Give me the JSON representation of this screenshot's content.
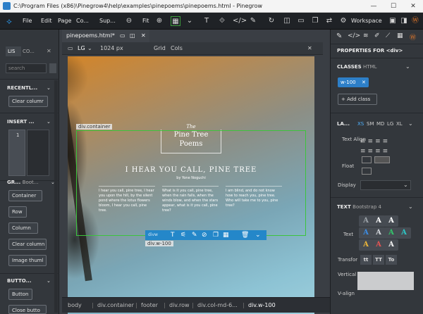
{
  "window": {
    "title": "C:\\Program Files (x86)\\Pinegrow4\\help\\examples\\pinepoems\\pinepoems.html - Pinegrow",
    "minimize": "—",
    "maximize": "☐",
    "close": "✕"
  },
  "menubar": {
    "items": [
      "File",
      "Edit",
      "Page",
      "Co...",
      "Sup..."
    ],
    "zoom_label": "Fit",
    "workspace_label": "Workspace"
  },
  "left_panel": {
    "tab_label": "LIS",
    "tab2_label": "CO...",
    "search_placeholder": "search",
    "recent_header": "RECENTL...",
    "recent_item": "Clear columr",
    "insert_header": "INSERT ...",
    "insert_num": "1",
    "grid_header": "GR...",
    "grid_sub": "Boot...",
    "grid_items": [
      "Container",
      "Row",
      "Column",
      "Clear column",
      "Image thuml"
    ],
    "buttons_header": "BUTTO...",
    "buttons_items": [
      "Button",
      "Close butto"
    ]
  },
  "canvas": {
    "doc_tab": "pinepoems.html*",
    "device": "LG",
    "width_px": "1024 px",
    "grid": "Grid",
    "cols": "Cols",
    "close": "✕",
    "container_label": "div.container",
    "logo_the": "The",
    "logo_line1": "Pine Tree",
    "logo_line2": "Poems",
    "headline": "I HEAR YOU CALL, PINE TREE",
    "byline": "by Yone Noguchi",
    "col1": "I hear you call, pine tree, I hear you upon the hill, by the silent pond where the lotus flowers bloom, I hear you call, pine tree.",
    "col2": "What is it you call, pine tree, when the rain falls, when the winds blow, and when the stars appear, what is it you call, pine tree?",
    "col3": "I am blind, and do not know how to reach you, pine tree. Who will take me to you, pine tree?",
    "selection_label": "div.w-100",
    "selection_toolbar_tag": "divw"
  },
  "breadcrumbs": [
    "body",
    "div.container",
    "footer",
    "div.row",
    "div.col-md-6...",
    "div.w-100"
  ],
  "right_panel": {
    "header": "PROPERTIES FOR <div>",
    "classes_header": "CLASSES",
    "classes_sub": "HTML",
    "class_chip": "w-100",
    "add_class": "+ Add class",
    "layout_header": "LA...",
    "breakpoints": [
      "XS",
      "SM",
      "MD",
      "LG",
      "XL"
    ],
    "text_align_label": "Text Align",
    "float_label": "Float",
    "display_label": "Display",
    "text_header": "TEXT",
    "text_sub": "Bootstrap 4",
    "text_label": "Text",
    "transform_label": "Transfor",
    "transform_opts": [
      "tt",
      "TT",
      "To"
    ],
    "vertical_label": "Vertical",
    "v_label": "V-align"
  },
  "colors": {
    "accent": "#2487c9",
    "selection_outline": "#3cc43c",
    "chip_bg": "#2d7fc8"
  }
}
